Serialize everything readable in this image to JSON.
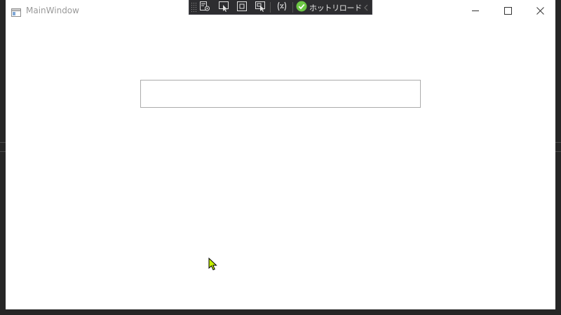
{
  "window": {
    "title": "MainWindow",
    "background": "#ffffff"
  },
  "title_bar": {
    "app_icon": "window-app-icon",
    "buttons": [
      {
        "name": "minimize",
        "icon": "minimize-icon"
      },
      {
        "name": "maximize",
        "icon": "maximize-icon"
      },
      {
        "name": "close",
        "icon": "close-icon"
      }
    ]
  },
  "debug_toolbar": {
    "background": "#2d2d30",
    "tools": [
      {
        "name": "live-visual-tree",
        "icon": "live-visual-tree-icon"
      },
      {
        "name": "select-element",
        "icon": "select-element-icon"
      },
      {
        "name": "display-adorners",
        "icon": "adorner-icon"
      },
      {
        "name": "track-focused-element",
        "icon": "track-focus-icon"
      },
      {
        "name": "binding-failures",
        "icon": "binding-icon"
      }
    ],
    "hot_reload": {
      "label": "ホットリロード",
      "status_icon": "check-circle-icon",
      "status_color": "#6cc644"
    },
    "collapse_icon": "chevron-left-icon"
  },
  "main": {
    "text_box": {
      "value": "",
      "placeholder": ""
    }
  },
  "mouse_cursor": {
    "icon": "arrow-cursor-icon",
    "color": "#c6f000"
  }
}
